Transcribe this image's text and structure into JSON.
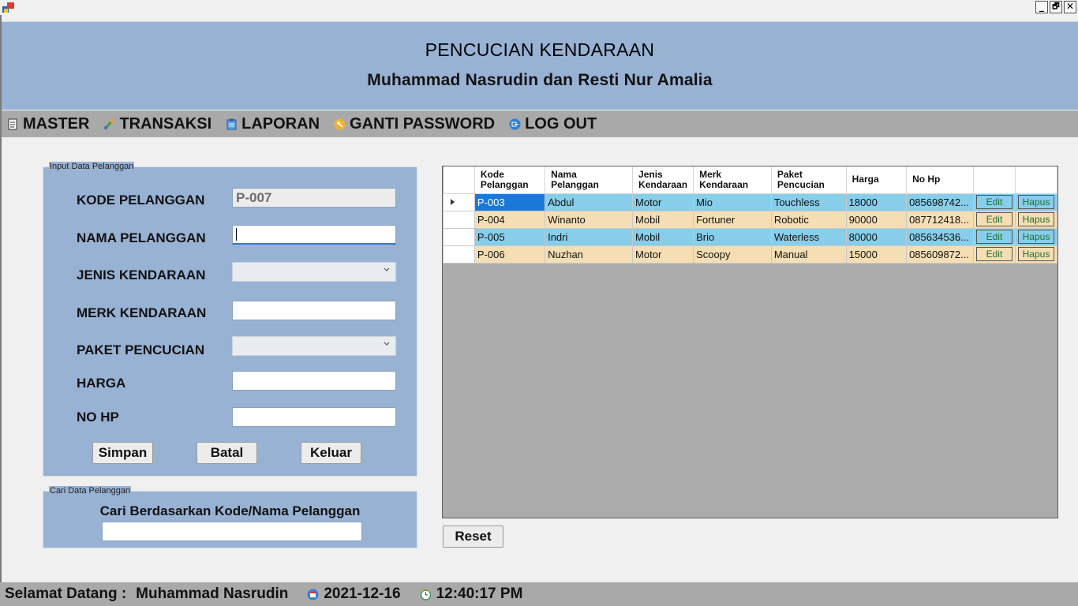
{
  "header": {
    "title": "PENCUCIAN KENDARAAN",
    "subtitle": "Muhammad Nasrudin dan Resti Nur Amalia"
  },
  "window_buttons": {
    "minimize": "_",
    "restore": "🗗",
    "close": "✕"
  },
  "menu": [
    {
      "label": "MASTER",
      "icon": "document-icon"
    },
    {
      "label": "TRANSAKSI",
      "icon": "transaction-icon"
    },
    {
      "label": "LAPORAN",
      "icon": "clipboard-icon"
    },
    {
      "label": "GANTI PASSWORD",
      "icon": "key-icon"
    },
    {
      "label": "LOG OUT",
      "icon": "logout-icon"
    }
  ],
  "input_group": {
    "caption": "Input Data Pelanggan",
    "fields": {
      "kode": {
        "label": "KODE PELANGGAN",
        "value": "P-007"
      },
      "nama": {
        "label": "NAMA PELANGGAN",
        "value": ""
      },
      "jenis": {
        "label": "JENIS KENDARAAN",
        "value": ""
      },
      "merk": {
        "label": "MERK KENDARAAN",
        "value": ""
      },
      "paket": {
        "label": "PAKET PENCUCIAN",
        "value": ""
      },
      "harga": {
        "label": "HARGA",
        "value": ""
      },
      "nohp": {
        "label": "NO HP",
        "value": ""
      }
    },
    "buttons": {
      "simpan": "Simpan",
      "batal": "Batal",
      "keluar": "Keluar"
    }
  },
  "search_group": {
    "caption": "Cari Data Pelanggan",
    "label": "Cari Berdasarkan Kode/Nama Pelanggan",
    "value": ""
  },
  "grid": {
    "columns": [
      {
        "line1": "Kode",
        "line2": "Pelanggan"
      },
      {
        "line1": "Nama",
        "line2": "Pelanggan"
      },
      {
        "line1": "Jenis",
        "line2": "Kendaraan"
      },
      {
        "line1": "Merk",
        "line2": "Kendaraan"
      },
      {
        "line1": "Paket",
        "line2": "Pencucian"
      },
      {
        "line1": "Harga",
        "line2": ""
      },
      {
        "line1": "No Hp",
        "line2": ""
      },
      {
        "line1": "",
        "line2": ""
      },
      {
        "line1": "",
        "line2": ""
      }
    ],
    "rows": [
      {
        "kode": "P-003",
        "nama": "Abdul",
        "jenis": "Motor",
        "merk": "Mio",
        "paket": "Touchless",
        "harga": "18000",
        "nohp": "085698742...",
        "edit": "Edit",
        "hapus": "Hapus"
      },
      {
        "kode": "P-004",
        "nama": "Winanto",
        "jenis": "Mobil",
        "merk": "Fortuner",
        "paket": "Robotic",
        "harga": "90000",
        "nohp": "087712418...",
        "edit": "Edit",
        "hapus": "Hapus"
      },
      {
        "kode": "P-005",
        "nama": "Indri",
        "jenis": "Mobil",
        "merk": "Brio",
        "paket": "Waterless",
        "harga": "80000",
        "nohp": "085634536...",
        "edit": "Edit",
        "hapus": "Hapus"
      },
      {
        "kode": "P-006",
        "nama": "Nuzhan",
        "jenis": "Motor",
        "merk": "Scoopy",
        "paket": "Manual",
        "harga": "15000",
        "nohp": "085609872...",
        "edit": "Edit",
        "hapus": "Hapus"
      }
    ],
    "row_colors": [
      "#87ceeb",
      "#f5deb3"
    ]
  },
  "reset_label": "Reset",
  "status": {
    "greeting": "Selamat Datang :",
    "user": "Muhammad Nasrudin",
    "date": "2021-12-16",
    "time": "12:40:17 PM"
  },
  "colors": {
    "header_bg": "#98b2d4",
    "menu_bg": "#a9a9a9",
    "selection": "#1a79d6"
  }
}
